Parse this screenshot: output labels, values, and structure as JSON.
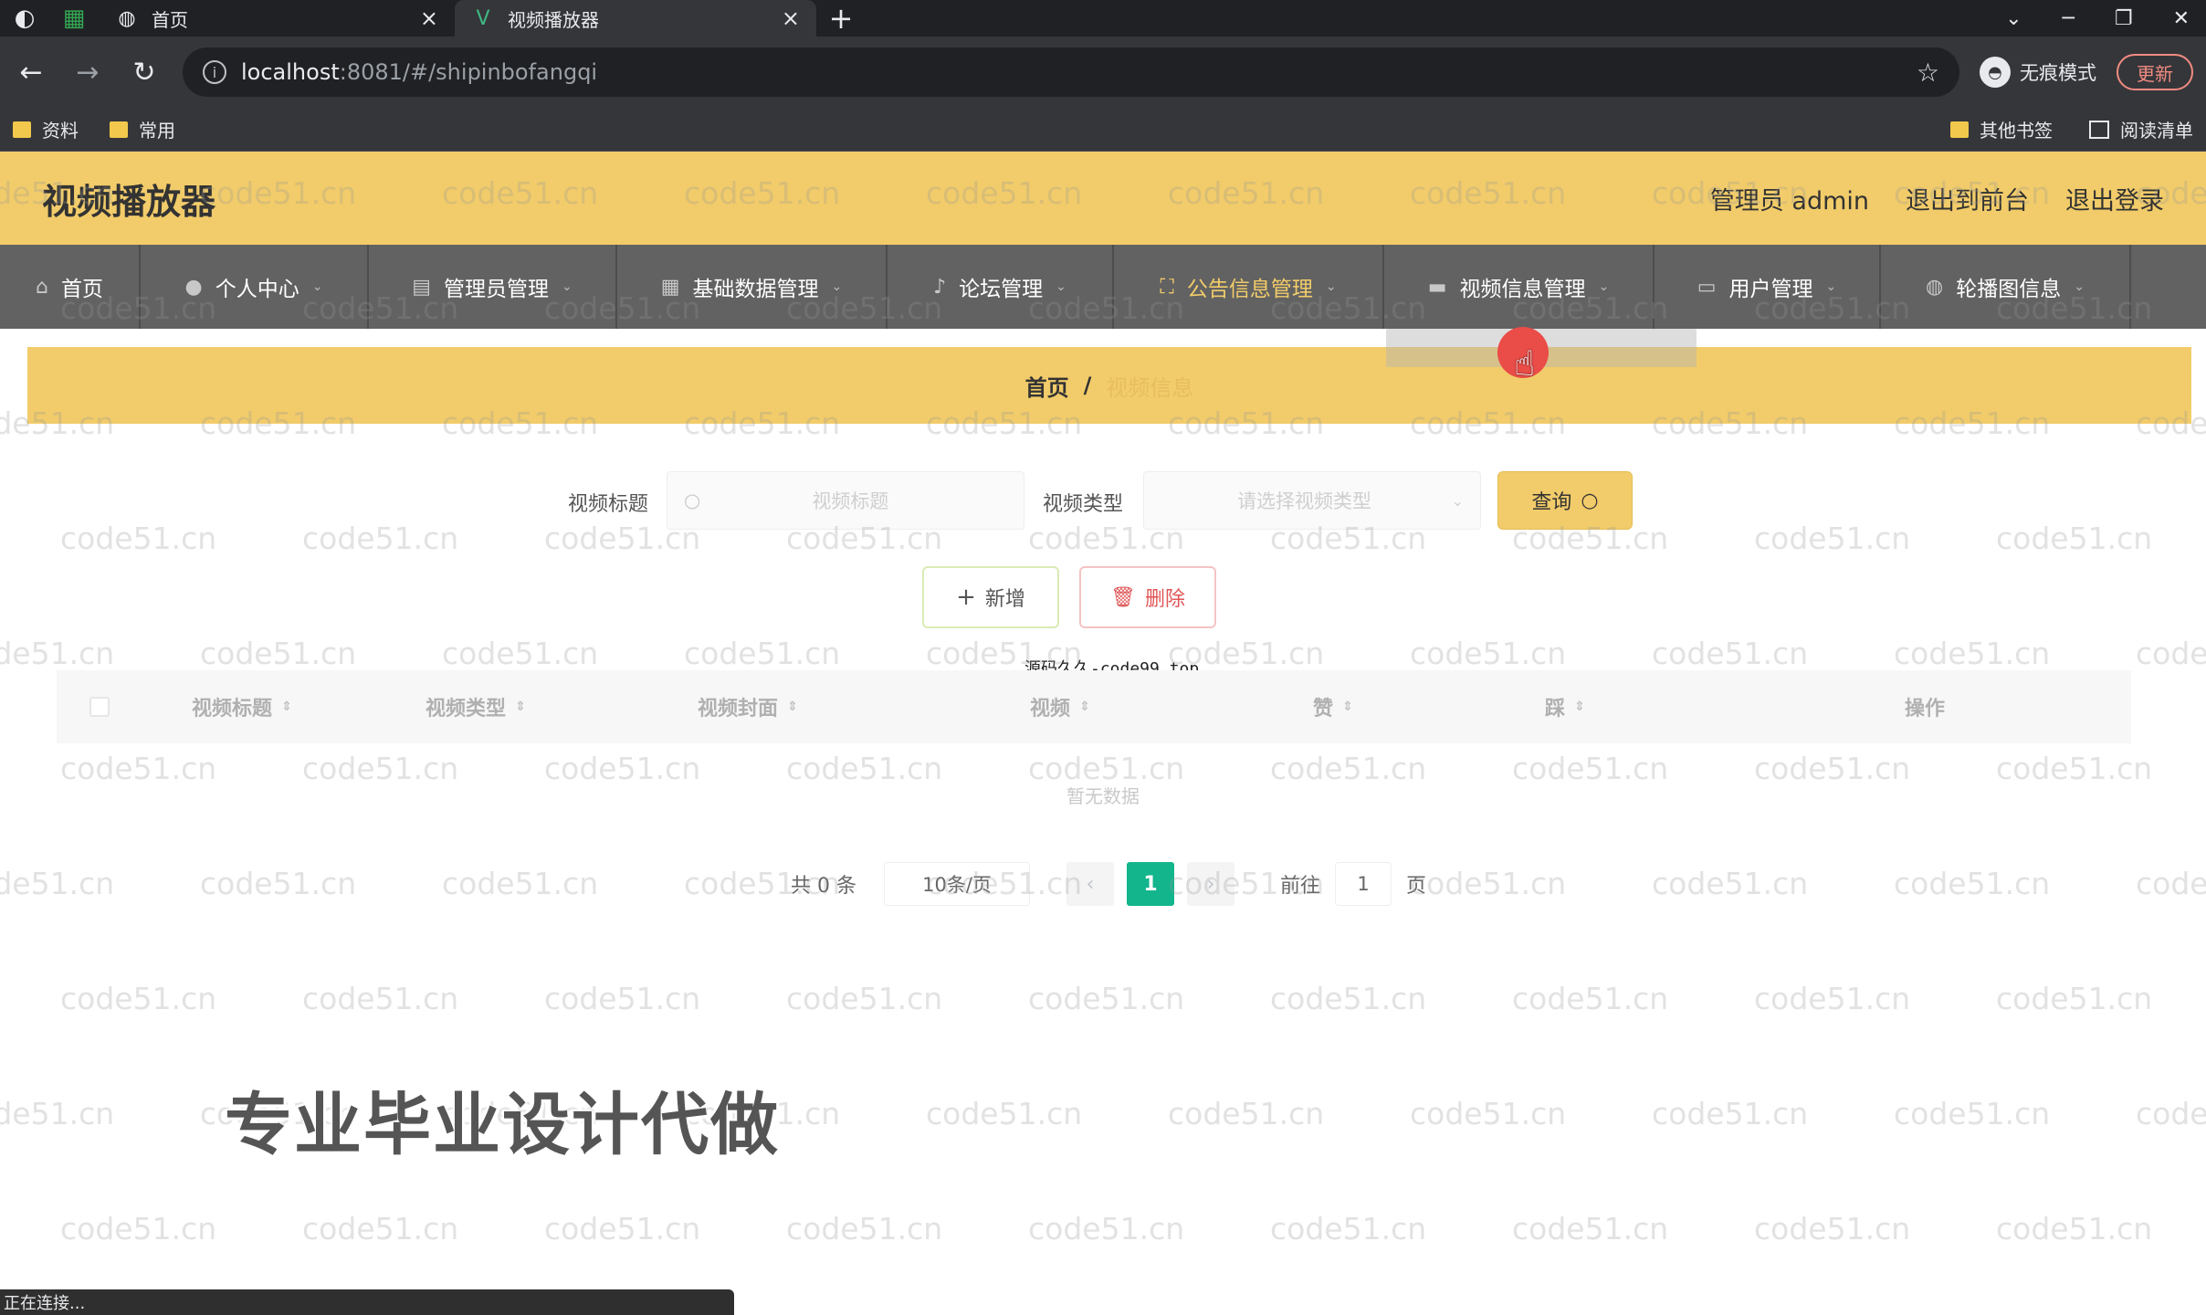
{
  "browser": {
    "tabs": [
      {
        "title": "首页",
        "close": "×",
        "favicon": "globe-icon"
      },
      {
        "title": "视频播放器",
        "close": "×",
        "favicon": "vue-icon"
      }
    ],
    "new_tab": "+",
    "url_host": "localhost",
    "url_path": ":8081/#/shipinbofangqi",
    "incognito_label": "无痕模式",
    "update_label": "更新",
    "bookmarks": [
      "资料",
      "常用"
    ],
    "bookmarks_right": [
      "其他书签",
      "阅读清单"
    ],
    "status_text": "正在连接..."
  },
  "app": {
    "title": "视频播放器",
    "user_label": "管理员 admin",
    "back_to_front": "退出到前台",
    "logout": "退出登录"
  },
  "nav": [
    {
      "label": "首页",
      "icon": "home-icon"
    },
    {
      "label": "个人中心",
      "icon": "user-icon"
    },
    {
      "label": "管理员管理",
      "icon": "doc-icon"
    },
    {
      "label": "基础数据管理",
      "icon": "grid-icon"
    },
    {
      "label": "论坛管理",
      "icon": "mic-icon"
    },
    {
      "label": "公告信息管理",
      "icon": "fullscreen-icon"
    },
    {
      "label": "视频信息管理",
      "icon": "monitor-icon"
    },
    {
      "label": "用户管理",
      "icon": "folder-icon"
    },
    {
      "label": "轮播图信息",
      "icon": "globe-icon"
    }
  ],
  "breadcrumb": {
    "home": "首页",
    "separator": "/",
    "current": "视频信息"
  },
  "search": {
    "title_label": "视频标题",
    "title_placeholder": "视频标题",
    "type_label": "视频类型",
    "type_placeholder": "请选择视频类型",
    "query_label": "查询"
  },
  "actions": {
    "add_label": "新增",
    "delete_label": "删除"
  },
  "source_note": "源码久久-code99.top",
  "table": {
    "columns": [
      "视频标题",
      "视频类型",
      "视频封面",
      "视频",
      "赞",
      "踩",
      "操作"
    ],
    "empty_text": "暂无数据"
  },
  "pagination": {
    "total_label": "共 0 条",
    "page_size": "10条/页",
    "current_page": "1",
    "goto_label": "前往",
    "goto_value": "1",
    "page_unit": "页"
  },
  "promo_text": "专业毕业设计代做",
  "watermark_text": "code51.cn",
  "colors": {
    "accent": "#f2cc6a",
    "nav_bg": "#626262",
    "page_active": "#13b58c"
  }
}
